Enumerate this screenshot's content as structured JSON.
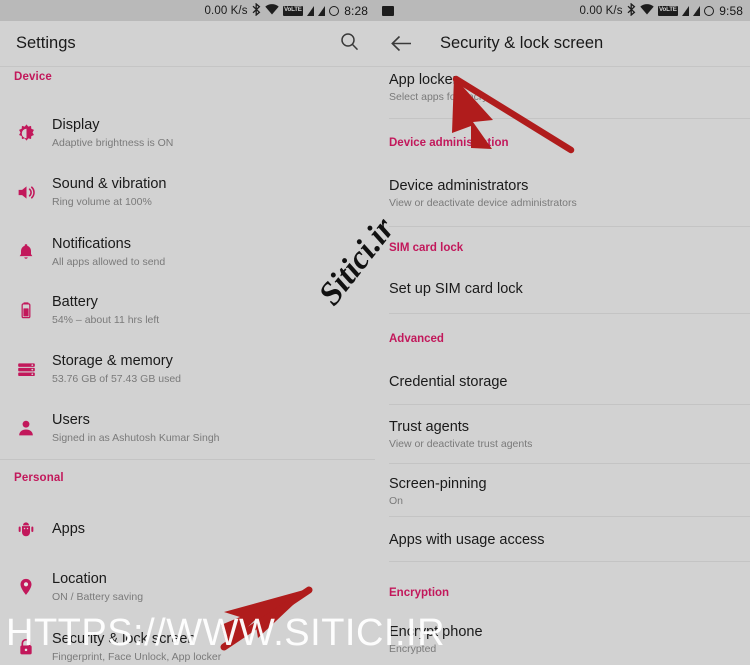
{
  "left": {
    "statusbar": {
      "speed": "0.00 K/s",
      "volte": "VoLTE",
      "time": "8:28",
      "icons": [
        "bluetooth-icon",
        "wifi-icon",
        "volte-icon",
        "signal-icon",
        "signal-icon",
        "alarm-icon"
      ]
    },
    "appbar": {
      "title": "Settings",
      "search_icon": "search-icon"
    },
    "sections": [
      {
        "header": "Device",
        "items": [
          {
            "icon": "brightness-icon",
            "title": "Display",
            "subtitle": "Adaptive brightness is ON"
          },
          {
            "icon": "volume-icon",
            "title": "Sound & vibration",
            "subtitle": "Ring volume at 100%"
          },
          {
            "icon": "bell-icon",
            "title": "Notifications",
            "subtitle": "All apps allowed to send"
          },
          {
            "icon": "battery-icon",
            "title": "Battery",
            "subtitle": "54% – about 11 hrs left"
          },
          {
            "icon": "storage-icon",
            "title": "Storage & memory",
            "subtitle": "53.76 GB of 57.43 GB used"
          },
          {
            "icon": "person-icon",
            "title": "Users",
            "subtitle": "Signed in as Ashutosh Kumar Singh"
          }
        ]
      },
      {
        "header": "Personal",
        "items": [
          {
            "icon": "android-bug-icon",
            "title": "Apps",
            "subtitle": ""
          },
          {
            "icon": "location-pin-icon",
            "title": "Location",
            "subtitle": "ON / Battery saving"
          },
          {
            "icon": "lock-icon",
            "title": "Security & lock screen",
            "subtitle": "Fingerprint, Face Unlock, App locker"
          }
        ]
      }
    ]
  },
  "right": {
    "statusbar": {
      "speed": "0.00 K/s",
      "volte": "VoLTE",
      "time": "9:58",
      "icons": [
        "screenshot-icon",
        "bluetooth-icon",
        "wifi-icon",
        "volte-icon",
        "signal-icon",
        "signal-icon",
        "alarm-icon"
      ]
    },
    "appbar": {
      "title": "Security & lock screen",
      "back_icon": "back-arrow-icon"
    },
    "rows": [
      {
        "type": "item",
        "title": "App locker",
        "subtitle": "Select apps for encry"
      },
      {
        "type": "section",
        "title": "Device administration"
      },
      {
        "type": "item",
        "title": "Device administrators",
        "subtitle": "View or deactivate device administrators"
      },
      {
        "type": "section",
        "title": "SIM card lock"
      },
      {
        "type": "item",
        "title": "Set up SIM card lock",
        "subtitle": ""
      },
      {
        "type": "section",
        "title": "Advanced"
      },
      {
        "type": "item",
        "title": "Credential storage",
        "subtitle": ""
      },
      {
        "type": "item",
        "title": "Trust agents",
        "subtitle": "View or deactivate trust agents"
      },
      {
        "type": "item",
        "title": "Screen-pinning",
        "subtitle": "On"
      },
      {
        "type": "item",
        "title": "Apps with usage access",
        "subtitle": ""
      },
      {
        "type": "section",
        "title": "Encryption"
      },
      {
        "type": "item",
        "title": "Encrypt phone",
        "subtitle": "Encrypted"
      }
    ]
  },
  "watermarks": {
    "main": "HTTPS://WWW.SITICI.IR",
    "diagonal": "Sitici.ir"
  },
  "colors": {
    "accent": "#c2185b",
    "arrow": "#b01c1c",
    "background": "#d2d2d2",
    "statusbar": "#b9b9b9"
  }
}
